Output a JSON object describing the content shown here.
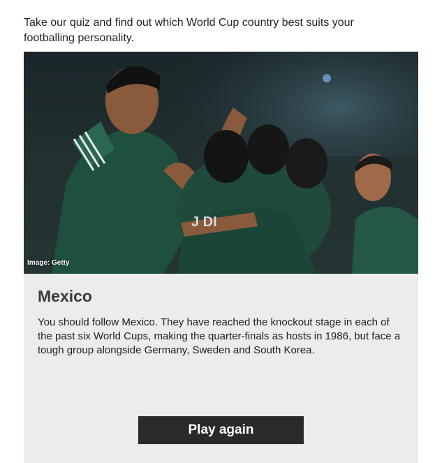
{
  "intro": "Take our quiz and find out which World Cup country best suits your footballing personality.",
  "result": {
    "image_credit": "Image: Getty",
    "title": "Mexico",
    "description": "You should follow Mexico. They have reached the knockout stage in each of the past six World Cups, making the quarter-finals as hosts in 1986, but face a tough group alongside Germany, Sweden and South Korea.",
    "play_again_label": "Play again"
  },
  "colors": {
    "card_background": "#ececec",
    "button_background": "#2a2a2a",
    "jersey_green": "#1f4f3f"
  }
}
